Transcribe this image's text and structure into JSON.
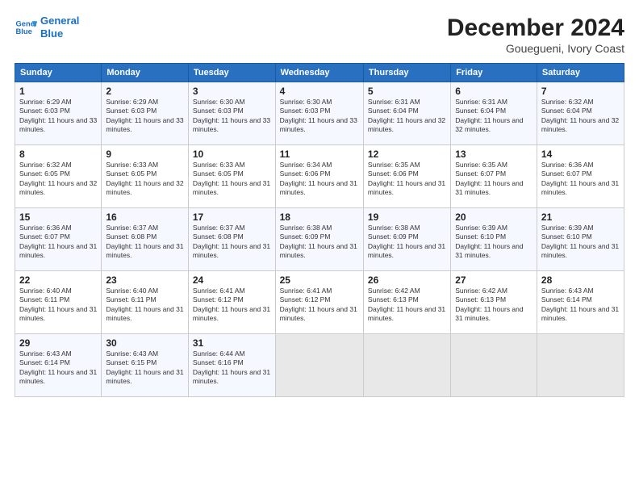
{
  "header": {
    "logo_line1": "General",
    "logo_line2": "Blue",
    "title": "December 2024",
    "subtitle": "Gouegueni, Ivory Coast"
  },
  "weekdays": [
    "Sunday",
    "Monday",
    "Tuesday",
    "Wednesday",
    "Thursday",
    "Friday",
    "Saturday"
  ],
  "weeks": [
    [
      {
        "day": 1,
        "sunrise": "6:29 AM",
        "sunset": "6:03 PM",
        "daylight": "11 hours and 33 minutes."
      },
      {
        "day": 2,
        "sunrise": "6:29 AM",
        "sunset": "6:03 PM",
        "daylight": "11 hours and 33 minutes."
      },
      {
        "day": 3,
        "sunrise": "6:30 AM",
        "sunset": "6:03 PM",
        "daylight": "11 hours and 33 minutes."
      },
      {
        "day": 4,
        "sunrise": "6:30 AM",
        "sunset": "6:03 PM",
        "daylight": "11 hours and 33 minutes."
      },
      {
        "day": 5,
        "sunrise": "6:31 AM",
        "sunset": "6:04 PM",
        "daylight": "11 hours and 32 minutes."
      },
      {
        "day": 6,
        "sunrise": "6:31 AM",
        "sunset": "6:04 PM",
        "daylight": "11 hours and 32 minutes."
      },
      {
        "day": 7,
        "sunrise": "6:32 AM",
        "sunset": "6:04 PM",
        "daylight": "11 hours and 32 minutes."
      }
    ],
    [
      {
        "day": 8,
        "sunrise": "6:32 AM",
        "sunset": "6:05 PM",
        "daylight": "11 hours and 32 minutes."
      },
      {
        "day": 9,
        "sunrise": "6:33 AM",
        "sunset": "6:05 PM",
        "daylight": "11 hours and 32 minutes."
      },
      {
        "day": 10,
        "sunrise": "6:33 AM",
        "sunset": "6:05 PM",
        "daylight": "11 hours and 31 minutes."
      },
      {
        "day": 11,
        "sunrise": "6:34 AM",
        "sunset": "6:06 PM",
        "daylight": "11 hours and 31 minutes."
      },
      {
        "day": 12,
        "sunrise": "6:35 AM",
        "sunset": "6:06 PM",
        "daylight": "11 hours and 31 minutes."
      },
      {
        "day": 13,
        "sunrise": "6:35 AM",
        "sunset": "6:07 PM",
        "daylight": "11 hours and 31 minutes."
      },
      {
        "day": 14,
        "sunrise": "6:36 AM",
        "sunset": "6:07 PM",
        "daylight": "11 hours and 31 minutes."
      }
    ],
    [
      {
        "day": 15,
        "sunrise": "6:36 AM",
        "sunset": "6:07 PM",
        "daylight": "11 hours and 31 minutes."
      },
      {
        "day": 16,
        "sunrise": "6:37 AM",
        "sunset": "6:08 PM",
        "daylight": "11 hours and 31 minutes."
      },
      {
        "day": 17,
        "sunrise": "6:37 AM",
        "sunset": "6:08 PM",
        "daylight": "11 hours and 31 minutes."
      },
      {
        "day": 18,
        "sunrise": "6:38 AM",
        "sunset": "6:09 PM",
        "daylight": "11 hours and 31 minutes."
      },
      {
        "day": 19,
        "sunrise": "6:38 AM",
        "sunset": "6:09 PM",
        "daylight": "11 hours and 31 minutes."
      },
      {
        "day": 20,
        "sunrise": "6:39 AM",
        "sunset": "6:10 PM",
        "daylight": "11 hours and 31 minutes."
      },
      {
        "day": 21,
        "sunrise": "6:39 AM",
        "sunset": "6:10 PM",
        "daylight": "11 hours and 31 minutes."
      }
    ],
    [
      {
        "day": 22,
        "sunrise": "6:40 AM",
        "sunset": "6:11 PM",
        "daylight": "11 hours and 31 minutes."
      },
      {
        "day": 23,
        "sunrise": "6:40 AM",
        "sunset": "6:11 PM",
        "daylight": "11 hours and 31 minutes."
      },
      {
        "day": 24,
        "sunrise": "6:41 AM",
        "sunset": "6:12 PM",
        "daylight": "11 hours and 31 minutes."
      },
      {
        "day": 25,
        "sunrise": "6:41 AM",
        "sunset": "6:12 PM",
        "daylight": "11 hours and 31 minutes."
      },
      {
        "day": 26,
        "sunrise": "6:42 AM",
        "sunset": "6:13 PM",
        "daylight": "11 hours and 31 minutes."
      },
      {
        "day": 27,
        "sunrise": "6:42 AM",
        "sunset": "6:13 PM",
        "daylight": "11 hours and 31 minutes."
      },
      {
        "day": 28,
        "sunrise": "6:43 AM",
        "sunset": "6:14 PM",
        "daylight": "11 hours and 31 minutes."
      }
    ],
    [
      {
        "day": 29,
        "sunrise": "6:43 AM",
        "sunset": "6:14 PM",
        "daylight": "11 hours and 31 minutes."
      },
      {
        "day": 30,
        "sunrise": "6:43 AM",
        "sunset": "6:15 PM",
        "daylight": "11 hours and 31 minutes."
      },
      {
        "day": 31,
        "sunrise": "6:44 AM",
        "sunset": "6:16 PM",
        "daylight": "11 hours and 31 minutes."
      },
      null,
      null,
      null,
      null
    ]
  ]
}
